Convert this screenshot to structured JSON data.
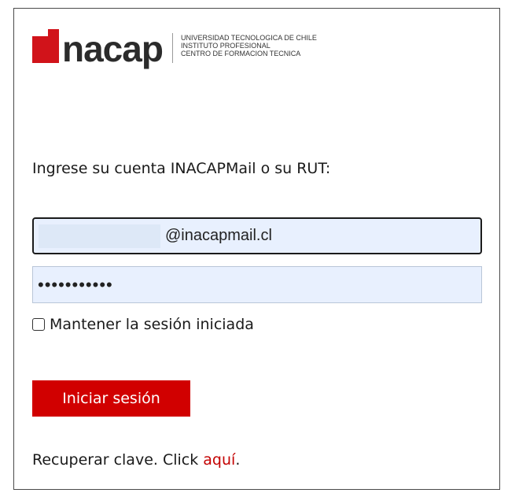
{
  "logo": {
    "wordmark": "nacap",
    "sub_lines": [
      "UNIVERSIDAD TECNOLOGICA DE CHILE",
      "INSTITUTO PROFESIONAL",
      "CENTRO DE FORMACION TECNICA"
    ],
    "brand_color": "#d1131a"
  },
  "form": {
    "prompt": "Ingrese su cuenta INACAPMail o su RUT:",
    "email_suffix": "@inacapmail.cl",
    "password_value": "•••••••••••",
    "remember_label": "Mantener la sesión iniciada",
    "remember_checked": false,
    "submit_label": "Iniciar sesión"
  },
  "recover": {
    "text": "Recuperar clave. Click ",
    "link_text": "aquí",
    "trailing": "."
  },
  "colors": {
    "button_bg": "#d10000",
    "link": "#c40000",
    "input_fill": "#e8f0fe"
  }
}
